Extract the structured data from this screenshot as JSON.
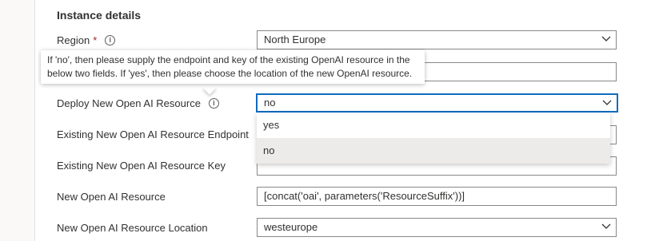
{
  "section": {
    "title": "Instance details"
  },
  "fields": {
    "region": {
      "label": "Region",
      "required_mark": "*",
      "value": "North Europe"
    },
    "deploy": {
      "label": "Deploy New Open AI Resource",
      "value": "no"
    },
    "endpoint": {
      "label": "Existing New Open AI Resource Endpoint",
      "value": ""
    },
    "key": {
      "label": "Existing New Open AI Resource Key",
      "value": ""
    },
    "new_resource": {
      "label": "New Open AI Resource",
      "value": "[concat('oai', parameters('ResourceSuffix'))]"
    },
    "location": {
      "label": "New Open AI Resource Location",
      "value": "westeurope"
    }
  },
  "tooltip": {
    "line1": "If 'no', then please supply the endpoint and key of the existing OpenAI resource in the",
    "line2": "below two fields. If 'yes', then please choose the location of the new OpenAI resource."
  },
  "dropdown": {
    "options": [
      "yes",
      "no"
    ],
    "selected": "no"
  },
  "icons": {
    "info": "info-icon",
    "chevron": "chevron-down-icon"
  },
  "colors": {
    "focus": "#0f6cbd",
    "required": "#a4262c",
    "selected_option": "#edebe9"
  }
}
